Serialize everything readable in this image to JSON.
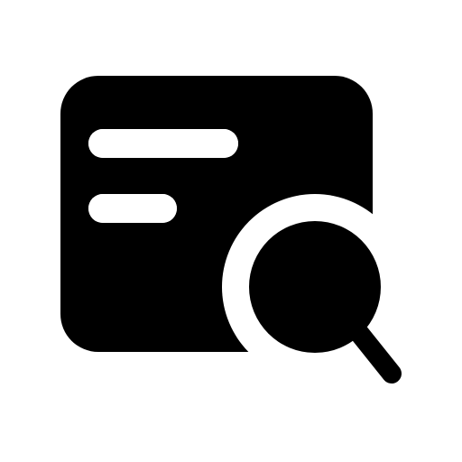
{
  "icon": {
    "name": "search-card-icon",
    "parts": [
      "card-icon",
      "text-lines",
      "magnifier-icon"
    ],
    "colors": {
      "foreground": "#000000",
      "background": "#ffffff"
    }
  }
}
